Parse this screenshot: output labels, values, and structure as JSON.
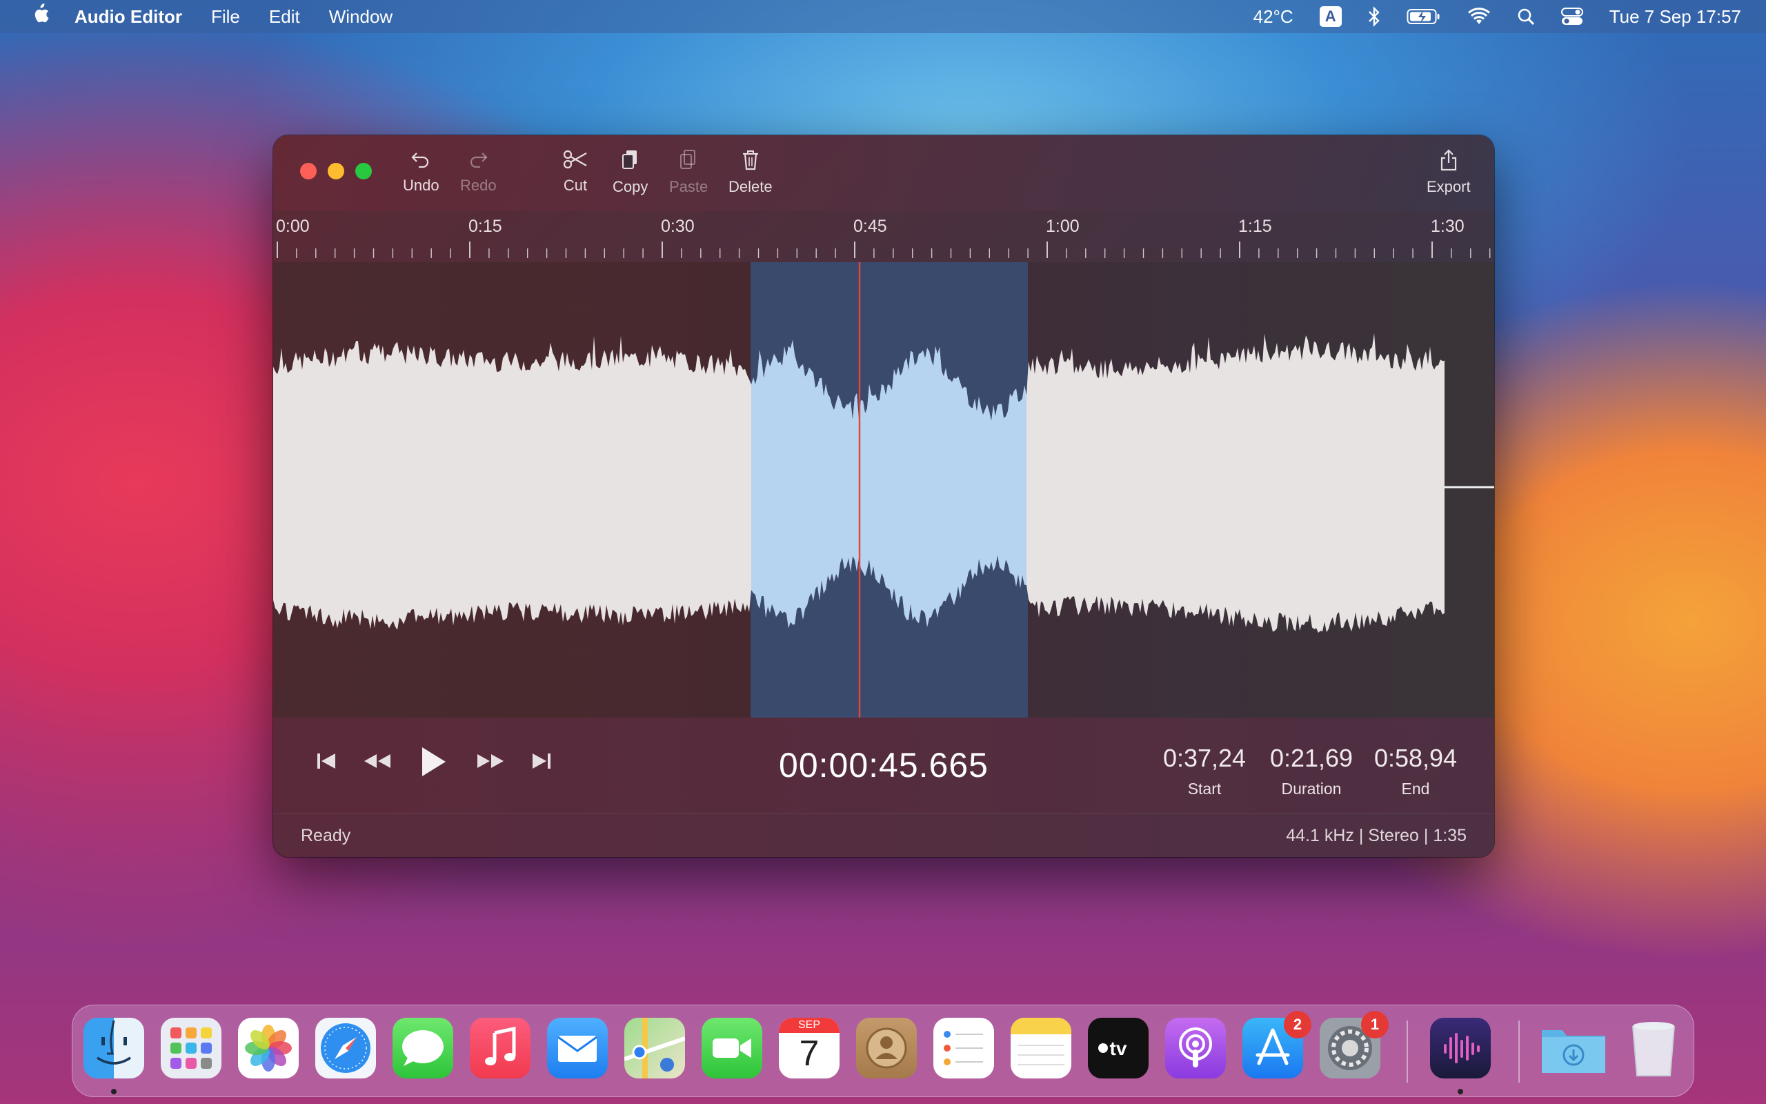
{
  "menubar": {
    "app_name": "Audio Editor",
    "menus": [
      "File",
      "Edit",
      "Window"
    ],
    "temperature": "42°C",
    "input_source": "A",
    "datetime": "Tue 7 Sep  17:57"
  },
  "window": {
    "toolbar": {
      "undo": "Undo",
      "redo": "Redo",
      "cut": "Cut",
      "copy": "Copy",
      "paste": "Paste",
      "delete": "Delete",
      "export": "Export"
    },
    "ruler_labels": [
      "0:00",
      "0:15",
      "0:30",
      "0:45",
      "1:00",
      "1:15",
      "1:30"
    ],
    "timecode": "00:00:45.665",
    "selection": {
      "start_value": "0:37,24",
      "start_label": "Start",
      "duration_value": "0:21,69",
      "duration_label": "Duration",
      "end_value": "0:58,94",
      "end_label": "End"
    },
    "status": {
      "left": "Ready",
      "right": "44.1 kHz  |  Stereo  |  1:35"
    }
  },
  "dock": {
    "apps": [
      "Finder",
      "Launchpad",
      "Photos",
      "Safari",
      "Messages",
      "Music",
      "Mail",
      "Maps",
      "FaceTime",
      "Calendar",
      "Contacts",
      "Reminders",
      "Notes",
      "TV",
      "Podcasts",
      "App Store",
      "System Preferences",
      "Audio Editor",
      "Downloads",
      "Trash"
    ],
    "calendar_month": "SEP",
    "calendar_day": "7",
    "appstore_badge": "2",
    "sysprefs_badge": "1"
  }
}
